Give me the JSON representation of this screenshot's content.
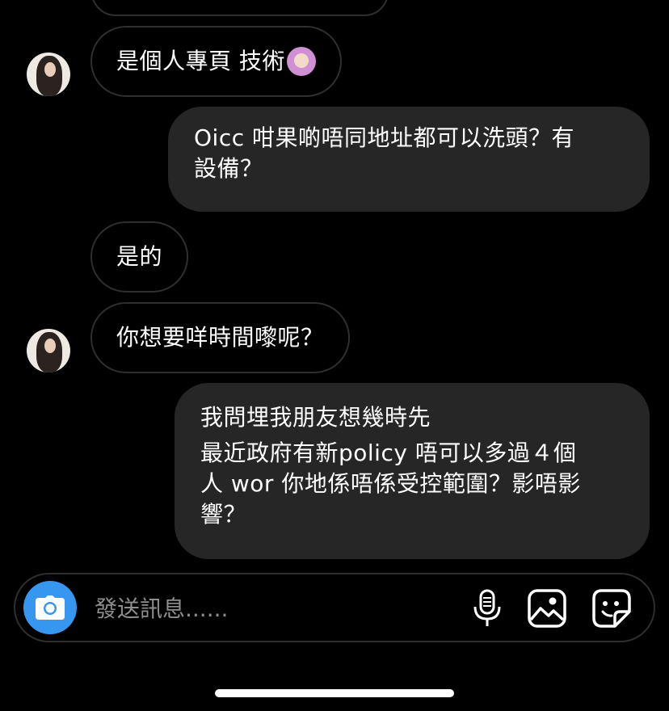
{
  "messages": [
    {
      "from": "them",
      "text": "是個人專頁 技術",
      "emoji": "person-gesturing-ok-emoji",
      "avatar": true
    },
    {
      "from": "me",
      "lines": [
        "Oicc 咁果啲唔同地址都可以洗頭？有",
        "設備？"
      ]
    },
    {
      "from": "them",
      "text": "是的",
      "avatar": false
    },
    {
      "from": "them",
      "text": "你想要咩時間嚟呢？",
      "avatar": true
    },
    {
      "from": "me",
      "lines": [
        "我問埋我朋友想幾時先",
        "最近政府有新policy 唔可以多過４個",
        "人 wor 你地係唔係受控範圍？影唔影",
        "響？"
      ]
    }
  ],
  "composer": {
    "placeholder": "發送訊息......",
    "icons": [
      "camera-icon",
      "microphone-icon",
      "image-icon",
      "sticker-icon"
    ]
  },
  "colors": {
    "background": "#000000",
    "outgoing_bubble": "#262626",
    "incoming_border": "#2f2f2f",
    "camera_button": "#3797f0",
    "placeholder": "#8e8e8e"
  }
}
